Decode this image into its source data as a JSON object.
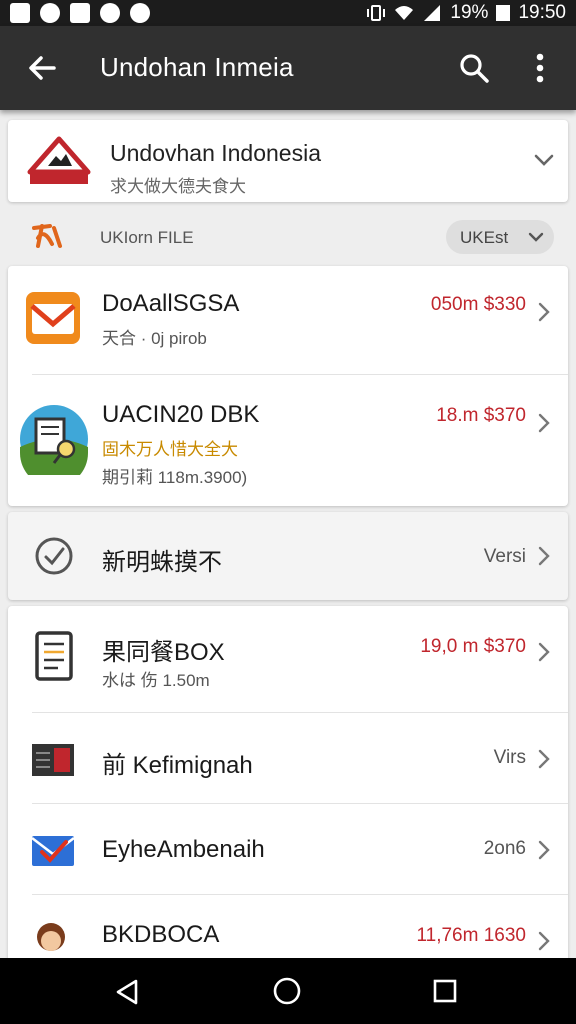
{
  "status_bar": {
    "battery": "19%",
    "time": "19:50"
  },
  "app_bar": {
    "title": "Undohan Inmeia"
  },
  "header_card": {
    "title": "Undovhan Indonesia",
    "subtitle": "求大做大德夫食大"
  },
  "section": {
    "label": "UKIorn FILE",
    "sort_label": "UKEst"
  },
  "items_group1": [
    {
      "title": "DoAallSGSA",
      "subtitle": "天合 · 0j pirob",
      "price": "050m $330",
      "icon": "mail-icon"
    },
    {
      "title": "UACIN20 DBK",
      "subtitle": "固木万人惜大全大",
      "subtitle2": "期引莉 118m.3900)",
      "price": "18.m $370",
      "icon": "landscape-document-icon"
    }
  ],
  "items_group2": [
    {
      "title": "新明蛛摸不",
      "meta": "Versi",
      "icon": "check-circle-icon"
    }
  ],
  "items_group3": [
    {
      "title": "果同餐BOX",
      "subtitle": "水は 伤 1.50m",
      "price": "19,0 m $370",
      "icon": "document-icon"
    },
    {
      "title": "前 Kefimignah",
      "meta": "Virs",
      "icon": "ledger-icon"
    },
    {
      "title": "EyheAmbenaih",
      "meta": "2on6",
      "icon": "email-check-icon"
    },
    {
      "title": "BKDBOCA",
      "price": "11,76m 1630",
      "icon": "avatar-icon"
    }
  ],
  "colors": {
    "accent_red": "#c0262d",
    "app_bar": "#303030"
  }
}
